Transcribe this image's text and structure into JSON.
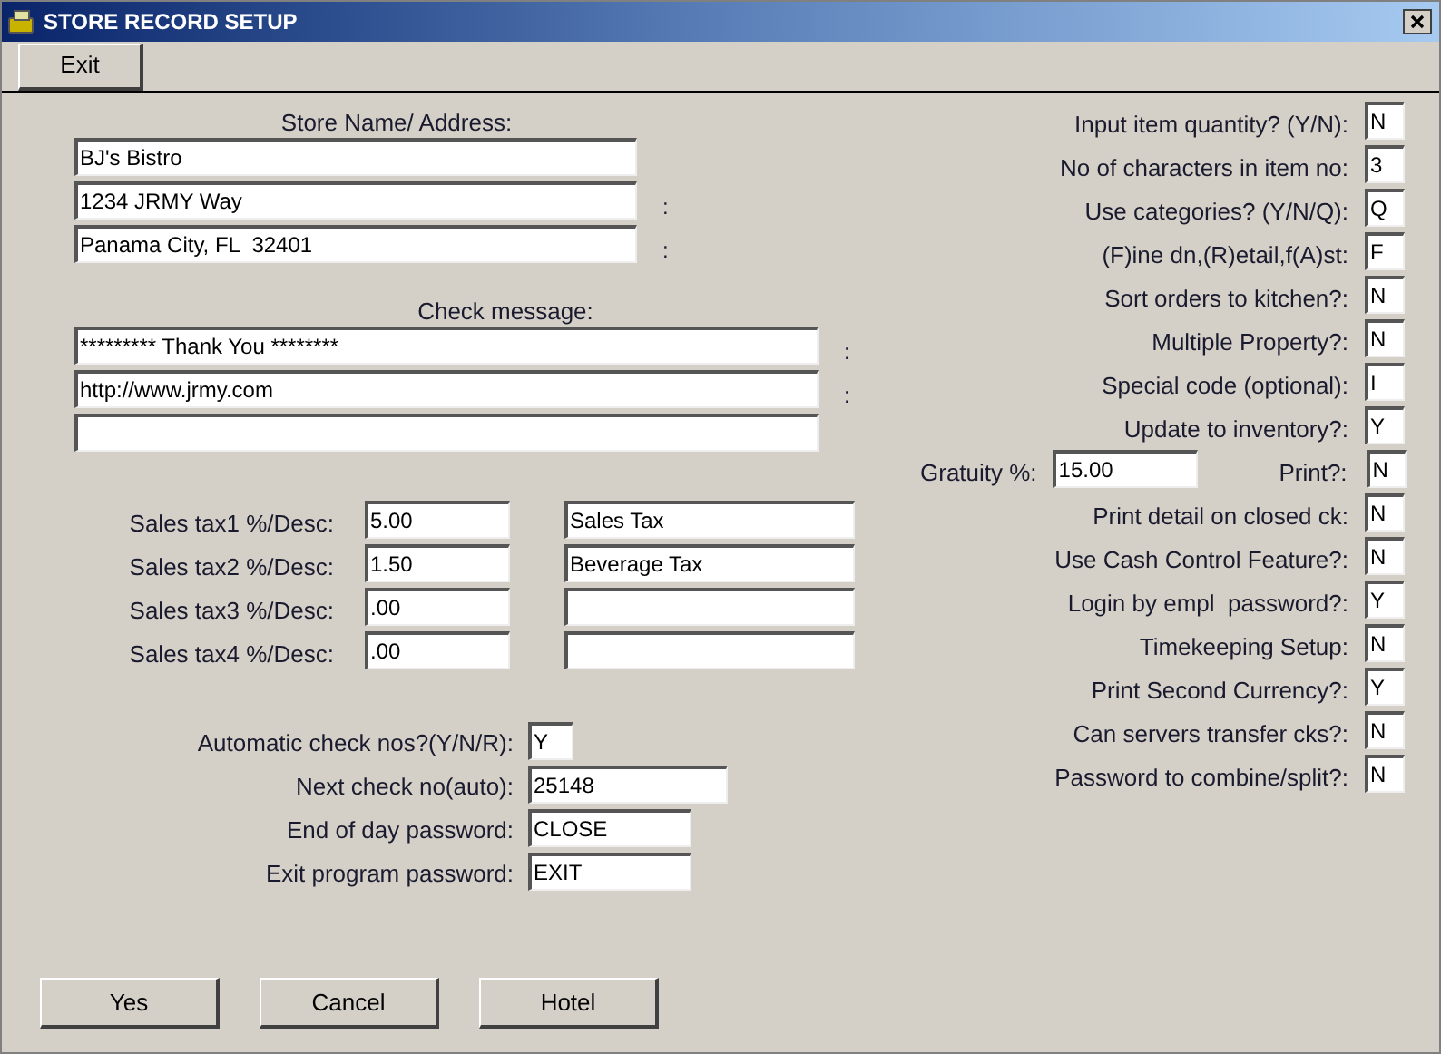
{
  "window": {
    "title": "STORE RECORD SETUP"
  },
  "toolbar": {
    "exit_button": "Exit"
  },
  "store": {
    "heading": "Store Name/ Address:",
    "lines": [
      {
        "value": "BJ's Bistro"
      },
      {
        "value": "1234 JRMY Way",
        "suffix": ":"
      },
      {
        "value": "Panama City, FL  32401",
        "suffix": ":"
      }
    ]
  },
  "check_message": {
    "heading": "Check message:",
    "lines": [
      {
        "value": "********* Thank You ********",
        "suffix": ":"
      },
      {
        "value": "http://www.jrmy.com",
        "suffix": ":"
      }
    ]
  },
  "taxes": [
    {
      "label": "Sales tax1 %/Desc:",
      "percent": "5.00",
      "desc": "Sales Tax"
    },
    {
      "label": "Sales tax2 %/Desc:",
      "percent": "1.50",
      "desc": "Beverage Tax"
    },
    {
      "label": "Sales tax3 %/Desc:",
      "percent": ".00"
    },
    {
      "label": "Sales tax4 %/Desc:",
      "percent": ".00"
    }
  ],
  "check_settings": [
    {
      "label": "Automatic check nos?(Y/N/R):",
      "value": "Y",
      "kind": "short"
    },
    {
      "label": "Next check no(auto):",
      "value": "25148",
      "kind": "long"
    },
    {
      "label": "End of day password:",
      "value": "CLOSE",
      "kind": "medium"
    },
    {
      "label": "Exit program password:",
      "value": "EXIT",
      "kind": "medium"
    }
  ],
  "options": [
    {
      "kind": "flag",
      "label": "Input item quantity? (Y/N):",
      "value": "N"
    },
    {
      "kind": "flag",
      "label": "No of characters in item no:",
      "value": "3"
    },
    {
      "kind": "flag",
      "label": "Use categories? (Y/N/Q):",
      "value": "Q"
    },
    {
      "kind": "flag",
      "label": "(F)ine dn,(R)etail,f(A)st:",
      "value": "F"
    },
    {
      "kind": "flag",
      "label": "Sort orders to kitchen?:",
      "value": "N"
    },
    {
      "kind": "flag",
      "label": "Multiple Property?:",
      "value": "N"
    },
    {
      "kind": "flag",
      "label": "Special code (optional):",
      "value": "I"
    },
    {
      "kind": "flag",
      "label": "Update to inventory?:",
      "value": "Y"
    },
    {
      "kind": "gratuity",
      "label": "Gratuity %:",
      "percent": "15.00",
      "print_label": "Print?:",
      "value": "N"
    },
    {
      "kind": "flag",
      "label": "Print detail on closed ck:",
      "value": "N"
    },
    {
      "kind": "flag",
      "label": "Use Cash Control Feature?:",
      "value": "N"
    },
    {
      "kind": "flag",
      "label": "Login by empl  password?:",
      "value": "Y"
    },
    {
      "kind": "flag",
      "label": "Timekeeping Setup:",
      "value": "N"
    },
    {
      "kind": "flag",
      "label": "Print Second Currency?:",
      "value": "Y"
    },
    {
      "kind": "flag",
      "label": "Can servers transfer cks?:",
      "value": "N"
    },
    {
      "kind": "flag",
      "label": "Password to combine/split?:",
      "value": "N"
    }
  ],
  "buttons": [
    "Yes",
    "Cancel",
    "Hotel"
  ]
}
